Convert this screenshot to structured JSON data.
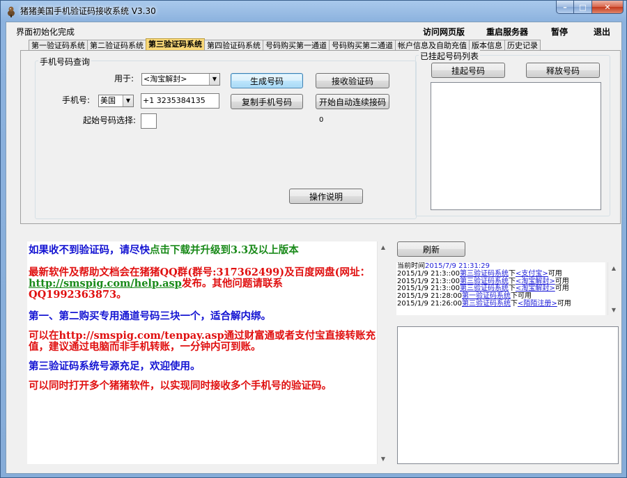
{
  "window": {
    "title": "猪猪美国手机验证码接收系统  V3.30",
    "minimize": "–",
    "maximize": "□",
    "close": "✕"
  },
  "menu": {
    "status": "界面初始化完成",
    "items": [
      "访问网页版",
      "重启服务器",
      "暂停",
      "退出"
    ]
  },
  "tabs": [
    {
      "label": "第一验证码系统"
    },
    {
      "label": "第二验证码系统"
    },
    {
      "label": "第三验证码系统",
      "active": true
    },
    {
      "label": "第四验证码系统"
    },
    {
      "label": "号码购买第一通道"
    },
    {
      "label": "号码购买第二通道"
    },
    {
      "label": "帐户信息及自助充值"
    },
    {
      "label": "版本信息"
    },
    {
      "label": "历史记录"
    }
  ],
  "phone_query": {
    "legend": "手机号码查询",
    "purpose_label": "用于:",
    "purpose_value": "<淘宝解封>",
    "phone_label": "手机号:",
    "country_value": "美国",
    "phone_value": "+1 3235384135",
    "start_label": "起始号码选择:",
    "start_value": "",
    "counter": "0",
    "buttons": {
      "generate": "生成号码",
      "receive": "接收验证码",
      "copy": "复制手机号码",
      "auto": "开始自动连续接码",
      "help": "操作说明"
    }
  },
  "hung_list": {
    "legend": "已挂起号码列表",
    "hang_button": "挂起号码",
    "release_button": "释放号码"
  },
  "info": {
    "line1_part1": "如果收不到验证码，请尽快",
    "line1_part2": "点击下载并升级到3.3及以上版本",
    "para2_part1": "最新软件及帮助文档会在猪猪QQ群(群号:317362499)及百度网盘(网址：",
    "para2_link": "http://smspig.com/help.asp",
    "para2_part2": "发布。其他问题请联系QQ1992363873。",
    "para3": "第一、第二购买专用通道号码三块一个，适合解内绑。",
    "para4": "可以在http://smspig.com/tenpay.asp通过财富通或者支付宝直接转账充值，建议通过电脑而非手机转账，一分钟内可到账。",
    "para5": "第三验证码系统号源充足，欢迎使用。",
    "para6": "可以同时打开多个猪猪软件，以实现同时接收多个手机号的验证码。"
  },
  "refresh_button": "刷新",
  "log": {
    "header_label": "当前时间",
    "header_time": "2015/7/9 21:31:29",
    "entries": [
      {
        "time": "2015/1/9 21:3::00",
        "system": "第三验证码系统",
        "mid": "下",
        "service": "<支付宝>",
        "status": "可用"
      },
      {
        "time": "2015/1/9 21:3::00",
        "system": "第三验证码系统",
        "mid": "下",
        "service": "<淘宝解封>",
        "status": "可用"
      },
      {
        "time": "2015/1/9 21:3::00",
        "system": "第三验证码系统",
        "mid": "下",
        "service": "<淘宝解封>",
        "status": "可用"
      },
      {
        "time": "2015/1/9 21:28:00",
        "system": "第一验证码系统",
        "mid": "下",
        "service": "",
        "status": "可用"
      },
      {
        "time": "2015/1/9 21:26:00",
        "system": "第三验证码系统",
        "mid": "下",
        "service": "<陌陌注册>",
        "status": "可用"
      }
    ]
  },
  "colors": {
    "active_tab": "#f9d878",
    "info_blue": "#1414d2",
    "info_red": "#e01010",
    "info_green": "#1a8a1a"
  }
}
